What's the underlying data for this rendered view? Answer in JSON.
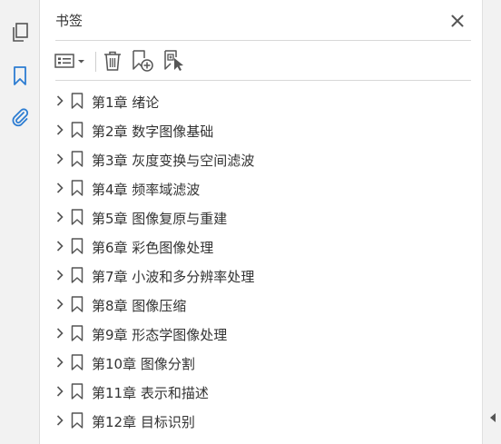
{
  "left_rail": {
    "items": [
      {
        "name": "pages-icon"
      },
      {
        "name": "bookmark-icon"
      },
      {
        "name": "attachment-icon"
      }
    ]
  },
  "panel": {
    "title": "书签"
  },
  "toolbar": {
    "buttons": [
      "options-menu",
      "delete-bookmark",
      "new-bookmark",
      "new-bookmark-from-structure"
    ]
  },
  "bookmarks": [
    {
      "label": "第1章  绪论"
    },
    {
      "label": "第2章  数字图像基础"
    },
    {
      "label": "第3章  灰度变换与空间滤波"
    },
    {
      "label": "第4章  频率域滤波"
    },
    {
      "label": "第5章  图像复原与重建"
    },
    {
      "label": "第6章  彩色图像处理"
    },
    {
      "label": "第7章  小波和多分辨率处理"
    },
    {
      "label": "第8章  图像压缩"
    },
    {
      "label": "第9章  形态学图像处理"
    },
    {
      "label": "第10章  图像分割"
    },
    {
      "label": "第11章  表示和描述"
    },
    {
      "label": "第12章  目标识别"
    }
  ],
  "colors": {
    "accent": "#2d7dd2",
    "icon": "#555555",
    "text": "#333333"
  }
}
